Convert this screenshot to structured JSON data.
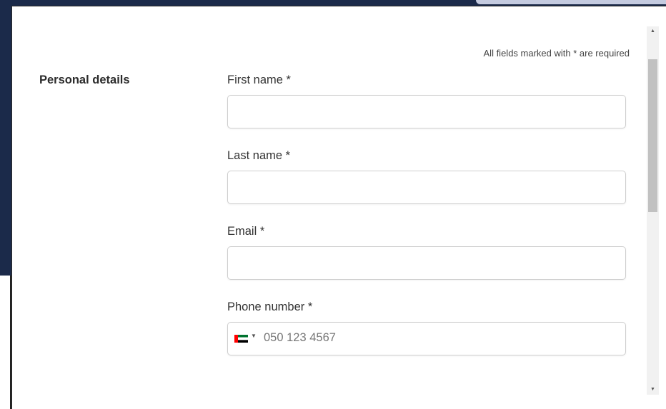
{
  "form": {
    "required_note": "All fields marked with * are required",
    "section_title": "Personal details",
    "fields": [
      {
        "label": "First name *",
        "value": ""
      },
      {
        "label": "Last name *",
        "value": ""
      },
      {
        "label": "Email *",
        "value": ""
      },
      {
        "label": "Phone number *",
        "placeholder": "050 123 4567",
        "country_flag": "uae-flag-icon"
      }
    ]
  },
  "colors": {
    "backdrop": "#1b2a4a",
    "input_border": "#cfcfcf"
  }
}
